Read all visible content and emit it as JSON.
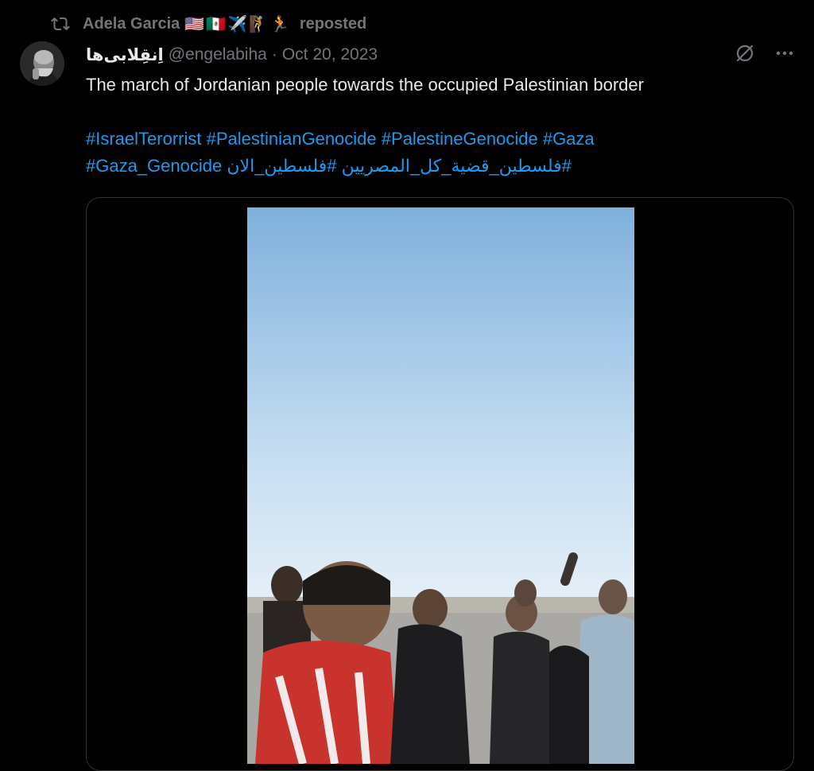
{
  "repost": {
    "name": "Adela Garcia",
    "emojis": "🇺🇸🇲🇽✈️🧗🏃",
    "suffix": "reposted"
  },
  "tweet": {
    "display_name": "اِنقِلابی‌ها",
    "handle": "@engelabiha",
    "separator": "·",
    "date": "Oct 20, 2023",
    "text": "The march of Jordanian people towards the occupied Palestinian border",
    "hashtags_line1": [
      "#IsraelTerorrist",
      "#PalestinianGenocide",
      "#PalestineGenocide",
      "#Gaza"
    ],
    "hashtags_line2": [
      "#Gaza_Genocide",
      "#فلسطين_الان",
      "#فلسطين_قضية_كل_المصريين"
    ]
  },
  "colors": {
    "background": "#000000",
    "text": "#e7e9ea",
    "muted": "#71767b",
    "link": "#1d9bf0",
    "border": "#2f3336"
  },
  "icons": {
    "repost": "repost-icon",
    "grok": "grok-icon",
    "more": "more-icon"
  }
}
